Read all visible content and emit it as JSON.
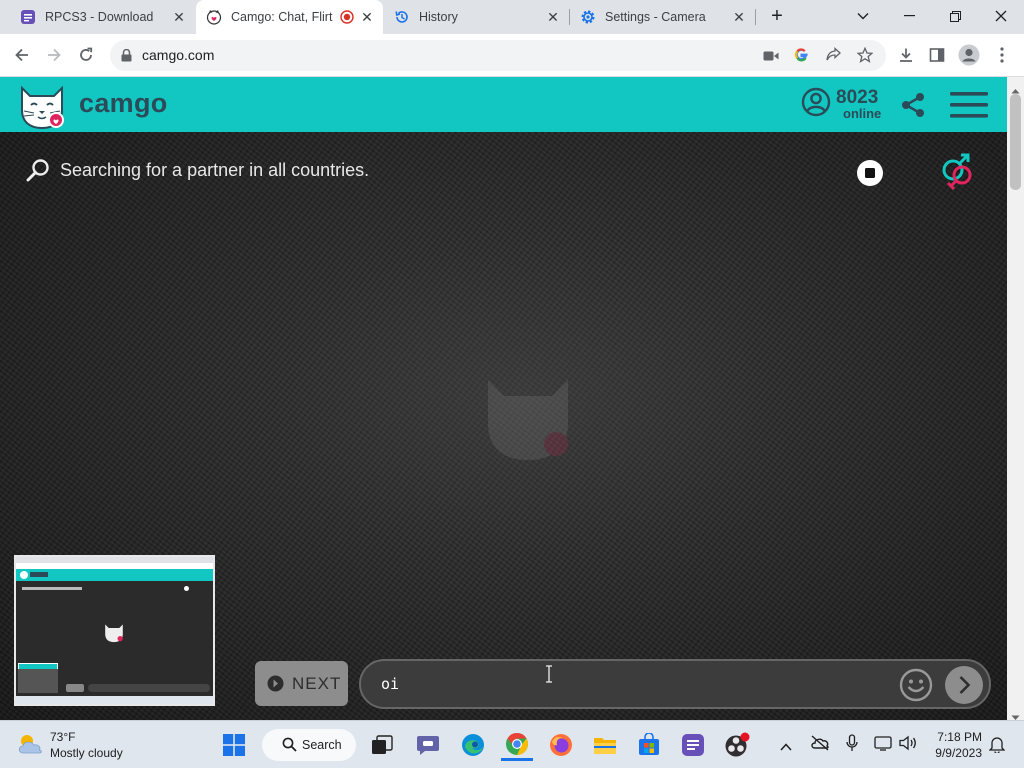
{
  "browser": {
    "tabs": [
      {
        "title": "RPCS3 - Download",
        "active": false
      },
      {
        "title": "Camgo: Chat, Flirt",
        "active": true
      },
      {
        "title": "History",
        "active": false
      },
      {
        "title": "Settings - Camera",
        "active": false
      }
    ],
    "url": "camgo.com"
  },
  "site": {
    "logo_text": "camgo",
    "online_count": "8023",
    "online_label": "online",
    "status_text": "Searching for a partner in all countries.",
    "next_label": "NEXT",
    "chat_value": "oi",
    "brand_color": "#12c7c2",
    "text_color": "#2a4b57"
  },
  "taskbar": {
    "weather_temp": "73°F",
    "weather_desc": "Mostly cloudy",
    "search_label": "Search",
    "time": "7:18 PM",
    "date": "9/9/2023",
    "apps": [
      "start-icon",
      "search-icon",
      "task-view-icon",
      "teams-chat-icon",
      "edge-icon",
      "chrome-icon",
      "firefox-icon",
      "file-explorer-icon",
      "store-icon",
      "notes-icon",
      "obs-icon"
    ]
  }
}
